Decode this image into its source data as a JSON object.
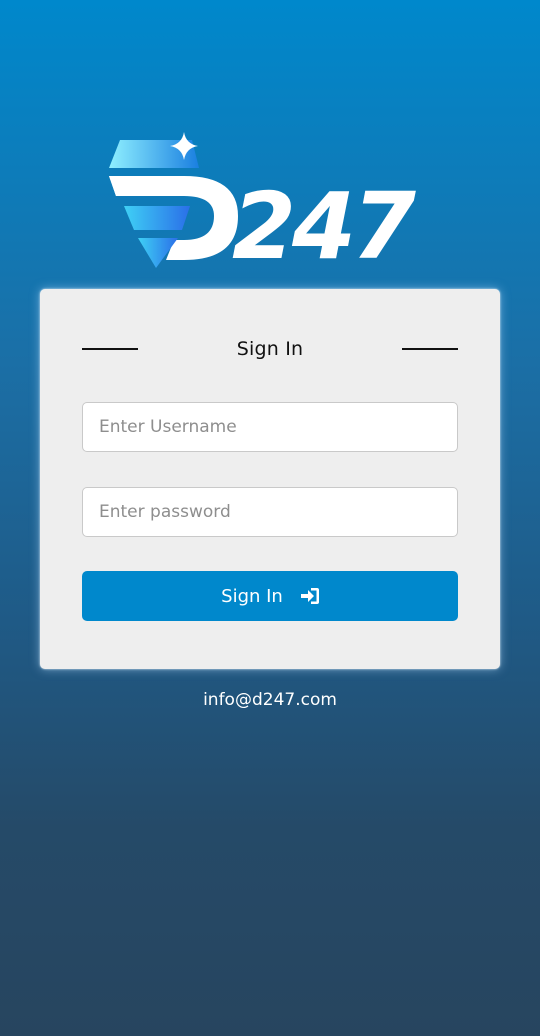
{
  "brand": {
    "logo_text": "D247"
  },
  "login": {
    "heading": "Sign In",
    "username_placeholder": "Enter Username",
    "password_placeholder": "Enter password",
    "submit_label": "Sign In",
    "submit_icon": "sign-in-icon"
  },
  "footer": {
    "email": "info@d247.com"
  },
  "colors": {
    "accent": "#0088cc",
    "card_background": "#eeeeee",
    "logo_gem_light": "#6ee0f5",
    "logo_gem_dark": "#1a8fe0"
  }
}
